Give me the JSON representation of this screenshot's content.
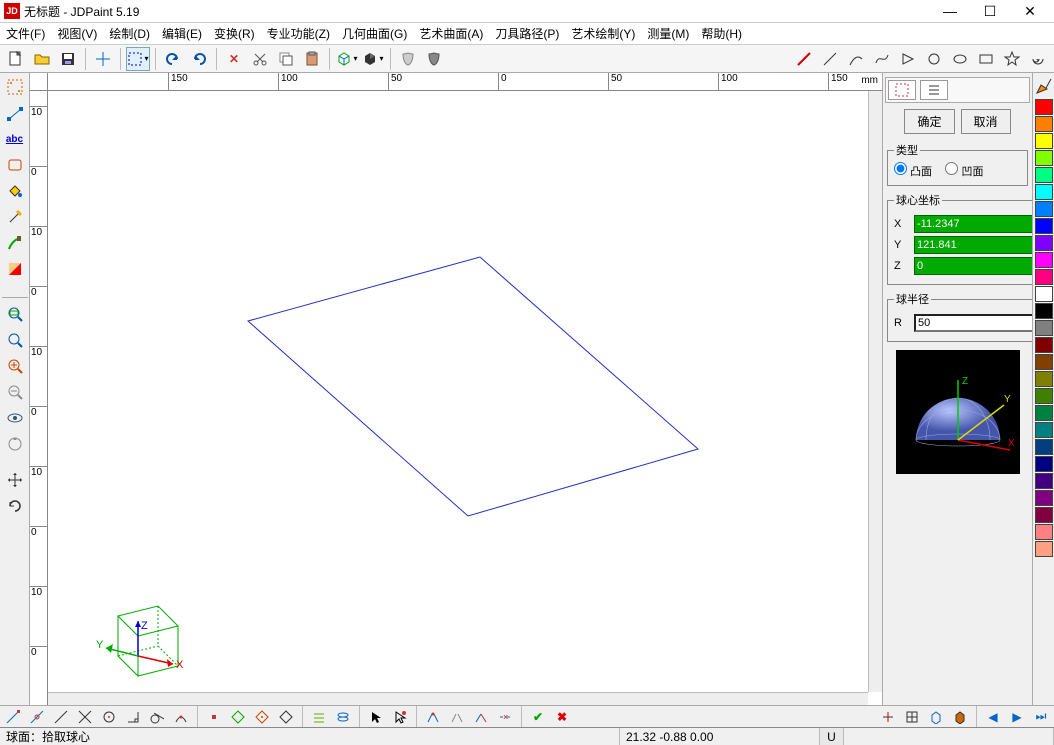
{
  "app": {
    "logo": "JD",
    "title": "无标题 - JDPaint 5.19"
  },
  "winbuttons": {
    "min": "—",
    "max": "☐",
    "close": "✕"
  },
  "menu": [
    "文件(F)",
    "视图(V)",
    "绘制(D)",
    "编辑(E)",
    "变换(R)",
    "专业功能(Z)",
    "几何曲面(G)",
    "艺术曲面(A)",
    "刀具路径(P)",
    "艺术绘制(Y)",
    "测量(M)",
    "帮助(H)"
  ],
  "ruler": {
    "unit": "mm",
    "h_ticks": [
      {
        "pos": 120,
        "label": "150"
      },
      {
        "pos": 230,
        "label": "100"
      },
      {
        "pos": 340,
        "label": "50"
      },
      {
        "pos": 450,
        "label": "0"
      },
      {
        "pos": 560,
        "label": "50"
      },
      {
        "pos": 670,
        "label": "100"
      },
      {
        "pos": 780,
        "label": "150"
      }
    ],
    "v_ticks": [
      {
        "pos": 15,
        "label": "10"
      },
      {
        "pos": 75,
        "label": "0"
      },
      {
        "pos": 135,
        "label": "10"
      },
      {
        "pos": 195,
        "label": "0"
      },
      {
        "pos": 255,
        "label": "10"
      },
      {
        "pos": 315,
        "label": "0"
      },
      {
        "pos": 375,
        "label": "10"
      },
      {
        "pos": 435,
        "label": "0"
      },
      {
        "pos": 495,
        "label": "10"
      },
      {
        "pos": 555,
        "label": "0"
      }
    ]
  },
  "panel": {
    "ok": "确定",
    "cancel": "取消",
    "type_legend": "类型",
    "type_opt1": "凸面",
    "type_opt2": "凹面",
    "center_legend": "球心坐标",
    "x_label": "X",
    "x_val": "-11.2347",
    "y_label": "Y",
    "y_val": "121.841",
    "z_label": "Z",
    "z_val": "0",
    "radius_legend": "球半径",
    "r_label": "R",
    "r_val": "50",
    "axis_x": "X",
    "axis_y": "Y",
    "axis_z": "Z"
  },
  "colors": [
    "#ff0000",
    "#ff8000",
    "#ffff00",
    "#80ff00",
    "#00ff80",
    "#00ffff",
    "#0080ff",
    "#0000ff",
    "#8000ff",
    "#ff00ff",
    "#ff0080",
    "#ffffff",
    "#000000",
    "#808080",
    "#800000",
    "#804000",
    "#808000",
    "#408000",
    "#008040",
    "#008080",
    "#004080",
    "#000080",
    "#400080",
    "#800080",
    "#800040",
    "#ff8080",
    "#ffa080"
  ],
  "overlaytabs": {
    "close": "×",
    "dropdown": "▾",
    "sq": "▫"
  },
  "status": {
    "left": "球面：拾取球心",
    "coords": "21.32 -0.88 0.00",
    "u": "U"
  },
  "cube_axes": {
    "x": "X",
    "y": "Y",
    "z": "Z"
  }
}
